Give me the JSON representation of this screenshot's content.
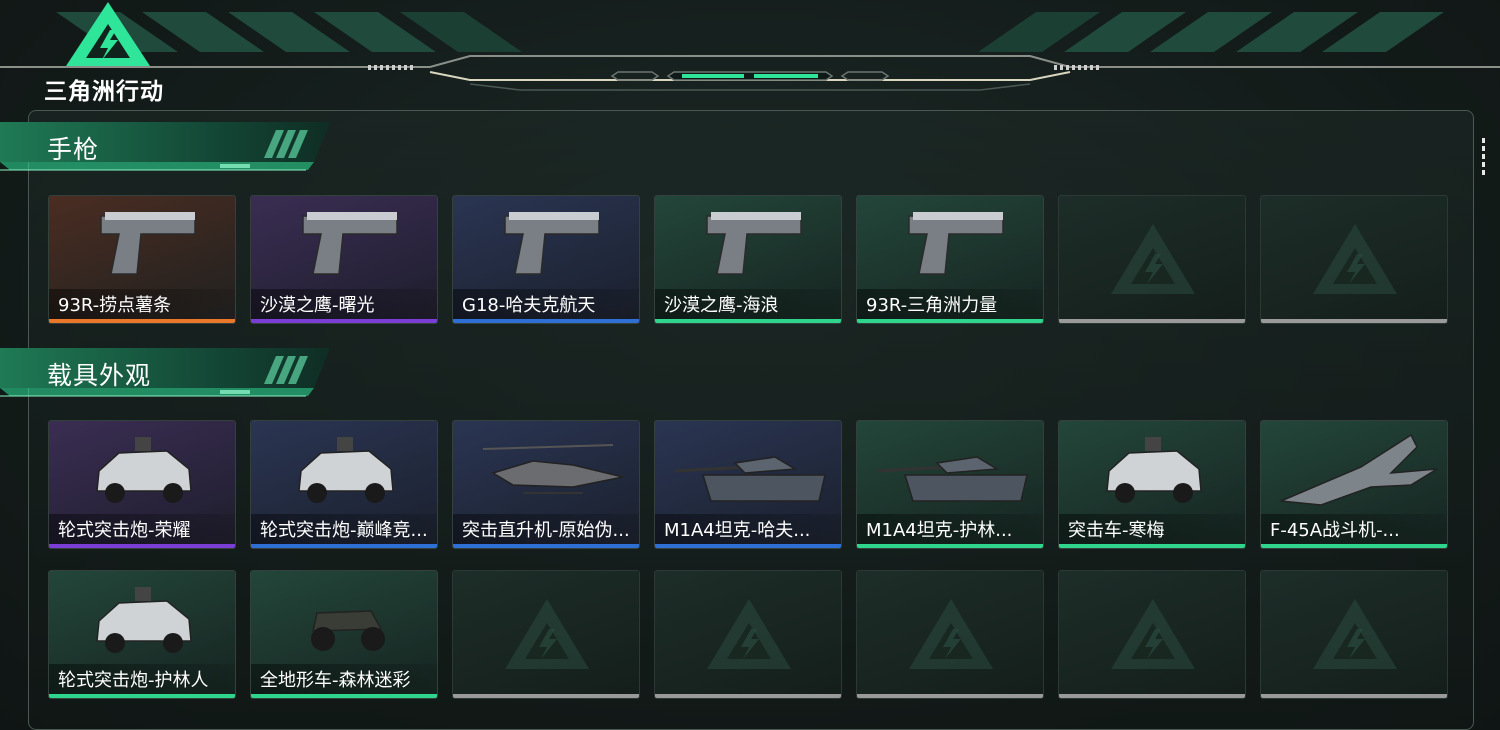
{
  "app": {
    "logo_text": "三角洲行动",
    "logo_icon": "delta-triangle-icon"
  },
  "colors": {
    "accent": "#2ee59a",
    "orange": "#e8772a",
    "purple": "#7a3ed6",
    "blue": "#2e6fd6",
    "green": "#2fd58c",
    "gray": "#9a9a9a"
  },
  "sections": [
    {
      "title": "手枪",
      "items": [
        {
          "name": "93R-捞点薯条",
          "rarity": "orange",
          "icon": "pistol-icon"
        },
        {
          "name": "沙漠之鹰-曙光",
          "rarity": "purple",
          "icon": "pistol-icon"
        },
        {
          "name": "G18-哈夫克航天",
          "rarity": "blue",
          "icon": "pistol-icon"
        },
        {
          "name": "沙漠之鹰-海浪",
          "rarity": "green",
          "icon": "pistol-icon"
        },
        {
          "name": "93R-三角洲力量",
          "rarity": "green",
          "icon": "pistol-icon"
        },
        {
          "name": "",
          "rarity": "gray",
          "icon": "empty-slot-icon"
        },
        {
          "name": "",
          "rarity": "gray",
          "icon": "empty-slot-icon"
        }
      ]
    },
    {
      "title": "载具外观",
      "items": [
        {
          "name": "轮式突击炮-荣耀",
          "rarity": "purple",
          "icon": "armored-car-icon"
        },
        {
          "name": "轮式突击炮-巅峰竞...",
          "rarity": "blue",
          "icon": "armored-car-icon"
        },
        {
          "name": "突击直升机-原始伪...",
          "rarity": "blue",
          "icon": "helicopter-icon"
        },
        {
          "name": "M1A4坦克-哈夫...",
          "rarity": "blue",
          "icon": "tank-icon"
        },
        {
          "name": "M1A4坦克-护林...",
          "rarity": "green",
          "icon": "tank-icon"
        },
        {
          "name": "突击车-寒梅",
          "rarity": "green",
          "icon": "assault-vehicle-icon"
        },
        {
          "name": "F-45A战斗机-...",
          "rarity": "green",
          "icon": "fighter-jet-icon"
        },
        {
          "name": "轮式突击炮-护林人",
          "rarity": "green",
          "icon": "armored-car-icon"
        },
        {
          "name": "全地形车-森林迷彩",
          "rarity": "green",
          "icon": "atv-icon"
        },
        {
          "name": "",
          "rarity": "gray",
          "icon": "empty-slot-icon"
        },
        {
          "name": "",
          "rarity": "gray",
          "icon": "empty-slot-icon"
        },
        {
          "name": "",
          "rarity": "gray",
          "icon": "empty-slot-icon"
        },
        {
          "name": "",
          "rarity": "gray",
          "icon": "empty-slot-icon"
        },
        {
          "name": "",
          "rarity": "gray",
          "icon": "empty-slot-icon"
        }
      ]
    }
  ]
}
